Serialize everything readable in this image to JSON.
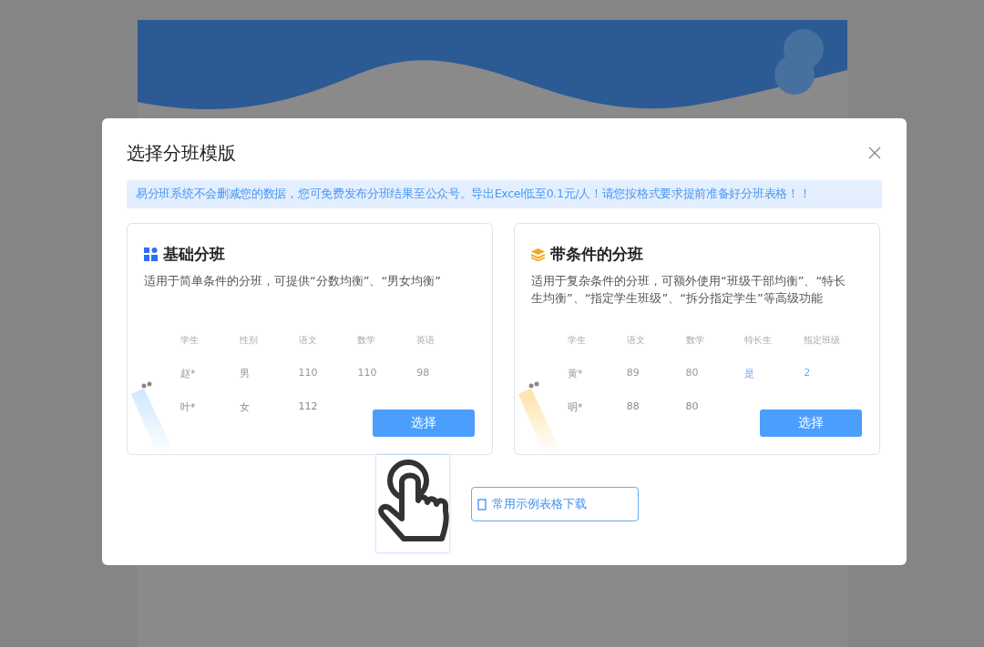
{
  "dialog": {
    "title": "选择分班模版",
    "notice": "易分班系统不会删减您的数据，您可免费发布分班结果至公众号。导出Excel低至0.1元/人！请您按格式要求提前准备好分班表格！！",
    "cards": [
      {
        "kind": "basic",
        "title": "基础分班",
        "description": "适用于简单条件的分班，可提供“分数均衡”、“男女均衡”",
        "columns": [
          {
            "label": "学生",
            "accent": false
          },
          {
            "label": "性别",
            "accent": false
          },
          {
            "label": "语文",
            "accent": false
          },
          {
            "label": "数学",
            "accent": false
          },
          {
            "label": "英语",
            "accent": false
          }
        ],
        "rows": [
          [
            "赵*",
            "男",
            "110",
            "110",
            "98"
          ],
          [
            "叶*",
            "女",
            "112"
          ]
        ],
        "button": "选择"
      },
      {
        "kind": "conditional",
        "title": "带条件的分班",
        "description": "适用于复杂条件的分班，可额外使用“班级干部均衡”、“特长生均衡”、“指定学生班级”、“拆分指定学生”等高级功能",
        "columns": [
          {
            "label": "学生",
            "accent": false
          },
          {
            "label": "语文",
            "accent": false
          },
          {
            "label": "数学",
            "accent": false
          },
          {
            "label": "特长生",
            "accent": true
          },
          {
            "label": "指定班级",
            "accent": true
          }
        ],
        "rows": [
          [
            "黄*",
            "89",
            "80",
            "是",
            "2"
          ],
          [
            "明*",
            "88",
            "80"
          ]
        ],
        "button": "选择"
      }
    ],
    "download_button": "常用示例表格下载"
  }
}
